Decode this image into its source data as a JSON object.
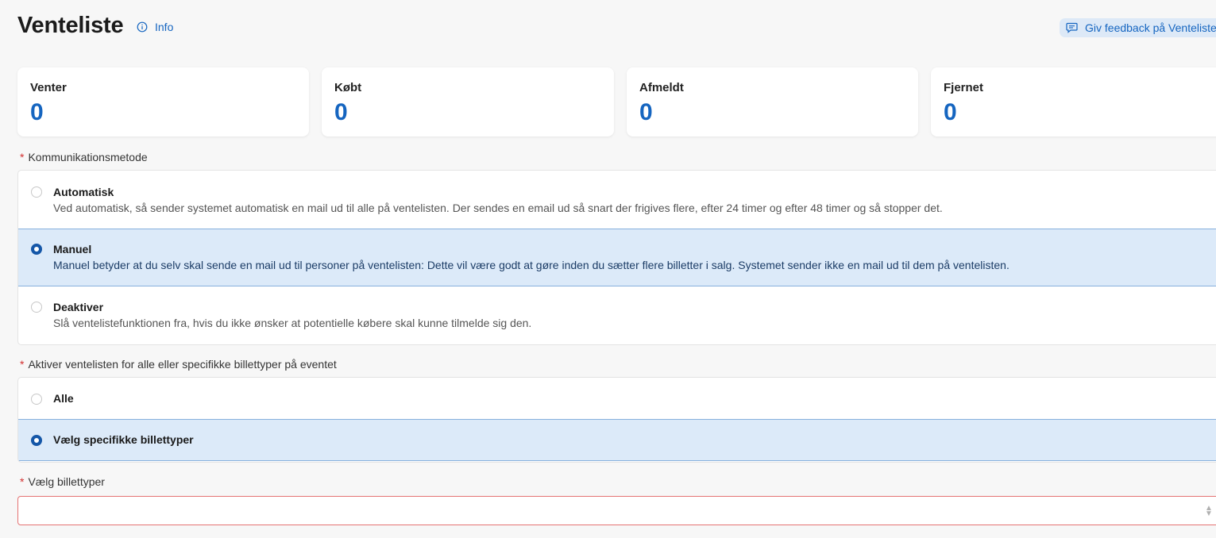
{
  "header": {
    "title": "Venteliste",
    "info_label": "Info",
    "feedback_label": "Giv feedback på Venteliste"
  },
  "stats": [
    {
      "label": "Venter",
      "value": "0"
    },
    {
      "label": "Købt",
      "value": "0"
    },
    {
      "label": "Afmeldt",
      "value": "0"
    },
    {
      "label": "Fjernet",
      "value": "0"
    }
  ],
  "communication": {
    "label": "Kommunikationsmetode",
    "required_mark": "*",
    "options": [
      {
        "title": "Automatisk",
        "description": "Ved automatisk, så sender systemet automatisk en mail ud til alle på ventelisten. Der sendes en email ud så snart der frigives flere, efter 24 timer og efter 48 timer og så stopper det.",
        "selected": false
      },
      {
        "title": "Manuel",
        "description": "Manuel betyder at du selv skal sende en mail ud til personer på ventelisten: Dette vil være godt at gøre inden du sætter flere billetter i salg. Systemet sender ikke en mail ud til dem på ventelisten.",
        "selected": true
      },
      {
        "title": "Deaktiver",
        "description": "Slå ventelistefunktionen fra, hvis du ikke ønsker at potentielle købere skal kunne tilmelde sig den.",
        "selected": false
      }
    ]
  },
  "ticket_scope": {
    "label": "Aktiver ventelisten for alle eller specifikke billettyper på eventet",
    "required_mark": "*",
    "options": [
      {
        "title": "Alle",
        "selected": false
      },
      {
        "title": "Vælg specifikke billettyper",
        "selected": true
      }
    ]
  },
  "ticket_select": {
    "label": "Vælg billettyper",
    "required_mark": "*",
    "value": ""
  },
  "colors": {
    "accent": "#1565c0",
    "selected_bg": "#dceaf9",
    "error_border": "#e57373"
  }
}
